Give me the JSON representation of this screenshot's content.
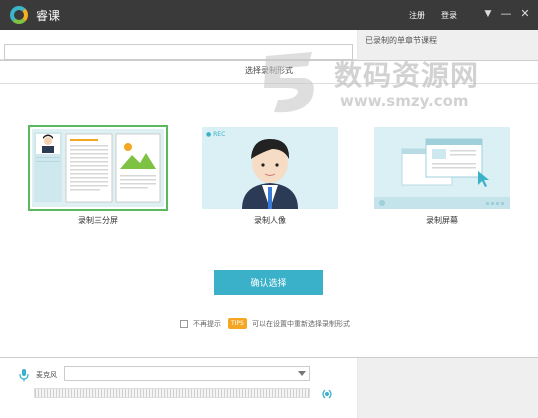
{
  "titlebar": {
    "app_name": "睿课",
    "register_label": "注册",
    "login_label": "登录",
    "menu_glyph": "▼",
    "minimize_glyph": "—",
    "close_glyph": "✕"
  },
  "right_panel": {
    "title": "已录制的单章节课程"
  },
  "dialog": {
    "title": "选择录制形式",
    "options": [
      {
        "label": "录制三分屏",
        "selected": true,
        "icon": "three-split-screen-icon"
      },
      {
        "label": "录制人像",
        "selected": false,
        "icon": "portrait-icon",
        "badge": "● REC"
      },
      {
        "label": "录制屏幕",
        "selected": false,
        "icon": "screen-record-icon"
      }
    ],
    "confirm_label": "确认选择",
    "dont_show_label": "不再提示",
    "tips_badge": "TIPS",
    "tip_text": "可以在设置中重新选择录制形式"
  },
  "mic": {
    "label": "麦克风",
    "selected_device": ""
  },
  "watermark": {
    "title": "数码资源网",
    "url": "www.smzy.com"
  },
  "colors": {
    "accent": "#3ab1c8",
    "selected_border": "#5cb85c",
    "tips": "#f5a623",
    "titlebar": "#3a3a3a"
  }
}
